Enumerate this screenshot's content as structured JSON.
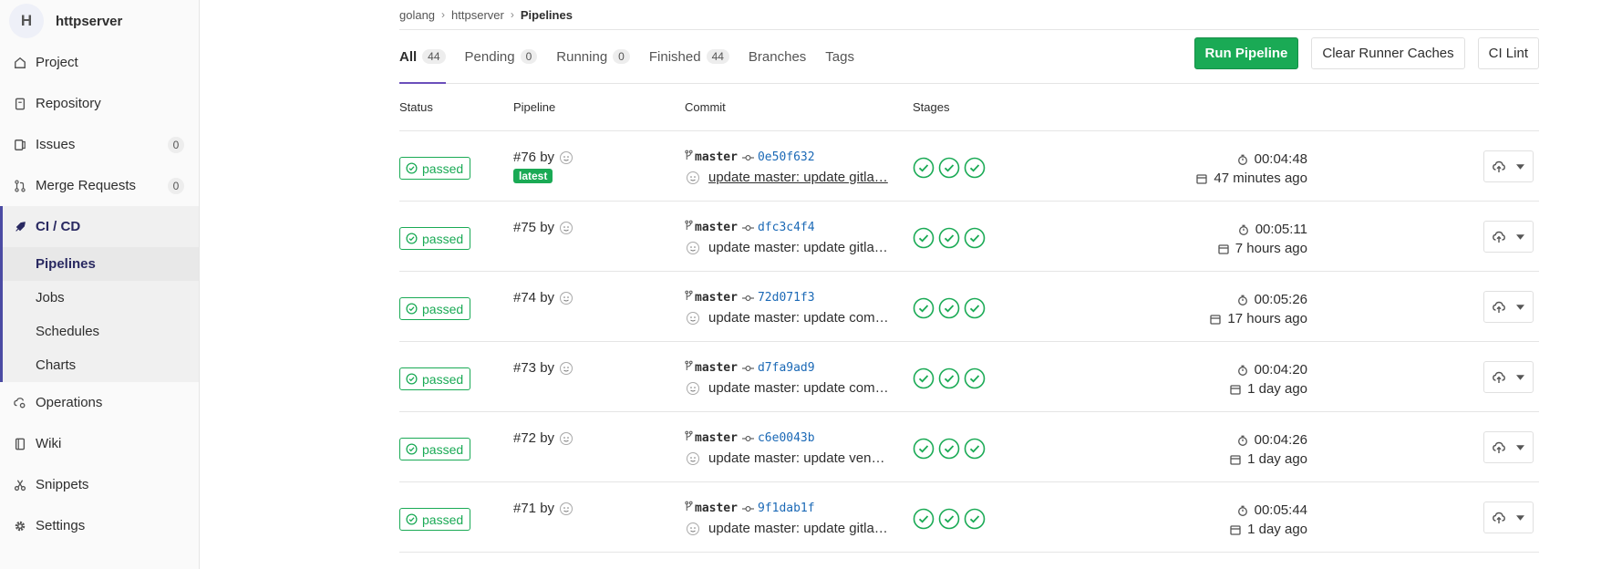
{
  "sidebar": {
    "avatar_letter": "H",
    "project_name": "httpserver",
    "items": [
      {
        "label": "Project",
        "icon": "home-icon"
      },
      {
        "label": "Repository",
        "icon": "doc-icon"
      },
      {
        "label": "Issues",
        "icon": "issues-icon",
        "count": "0"
      },
      {
        "label": "Merge Requests",
        "icon": "merge-icon",
        "count": "0"
      },
      {
        "label": "CI / CD",
        "icon": "rocket-icon"
      },
      {
        "label": "Operations",
        "icon": "cloud-gear-icon"
      },
      {
        "label": "Wiki",
        "icon": "book-icon"
      },
      {
        "label": "Snippets",
        "icon": "scissors-icon"
      },
      {
        "label": "Settings",
        "icon": "gear-icon"
      }
    ],
    "cicd_sub": [
      "Pipelines",
      "Jobs",
      "Schedules",
      "Charts"
    ]
  },
  "breadcrumb": [
    "golang",
    "httpserver",
    "Pipelines"
  ],
  "tabs": [
    {
      "label": "All",
      "count": "44"
    },
    {
      "label": "Pending",
      "count": "0"
    },
    {
      "label": "Running",
      "count": "0"
    },
    {
      "label": "Finished",
      "count": "44"
    },
    {
      "label": "Branches"
    },
    {
      "label": "Tags"
    }
  ],
  "buttons": {
    "run": "Run Pipeline",
    "clear": "Clear Runner Caches",
    "lint": "CI Lint"
  },
  "columns": {
    "status": "Status",
    "pipeline": "Pipeline",
    "commit": "Commit",
    "stages": "Stages"
  },
  "colors": {
    "success": "#1aaa55",
    "link": "#1b69b6",
    "accent": "#6b4fbb"
  },
  "rows": [
    {
      "status": "passed",
      "id": "#76",
      "by": "by",
      "latest": "latest",
      "branch": "master",
      "sha": "0e50f632",
      "message": "update master: update gitla…",
      "duration": "00:04:48",
      "finished": "47 minutes ago"
    },
    {
      "status": "passed",
      "id": "#75",
      "by": "by",
      "branch": "master",
      "sha": "dfc3c4f4",
      "message": "update master: update gitla…",
      "duration": "00:05:11",
      "finished": "7 hours ago"
    },
    {
      "status": "passed",
      "id": "#74",
      "by": "by",
      "branch": "master",
      "sha": "72d071f3",
      "message": "update master: update com…",
      "duration": "00:05:26",
      "finished": "17 hours ago"
    },
    {
      "status": "passed",
      "id": "#73",
      "by": "by",
      "branch": "master",
      "sha": "d7fa9ad9",
      "message": "update master: update com…",
      "duration": "00:04:20",
      "finished": "1 day ago"
    },
    {
      "status": "passed",
      "id": "#72",
      "by": "by",
      "branch": "master",
      "sha": "c6e0043b",
      "message": "update master: update vendor",
      "duration": "00:04:26",
      "finished": "1 day ago"
    },
    {
      "status": "passed",
      "id": "#71",
      "by": "by",
      "branch": "master",
      "sha": "9f1dab1f",
      "message": "update master: update gitla…",
      "duration": "00:05:44",
      "finished": "1 day ago"
    }
  ]
}
